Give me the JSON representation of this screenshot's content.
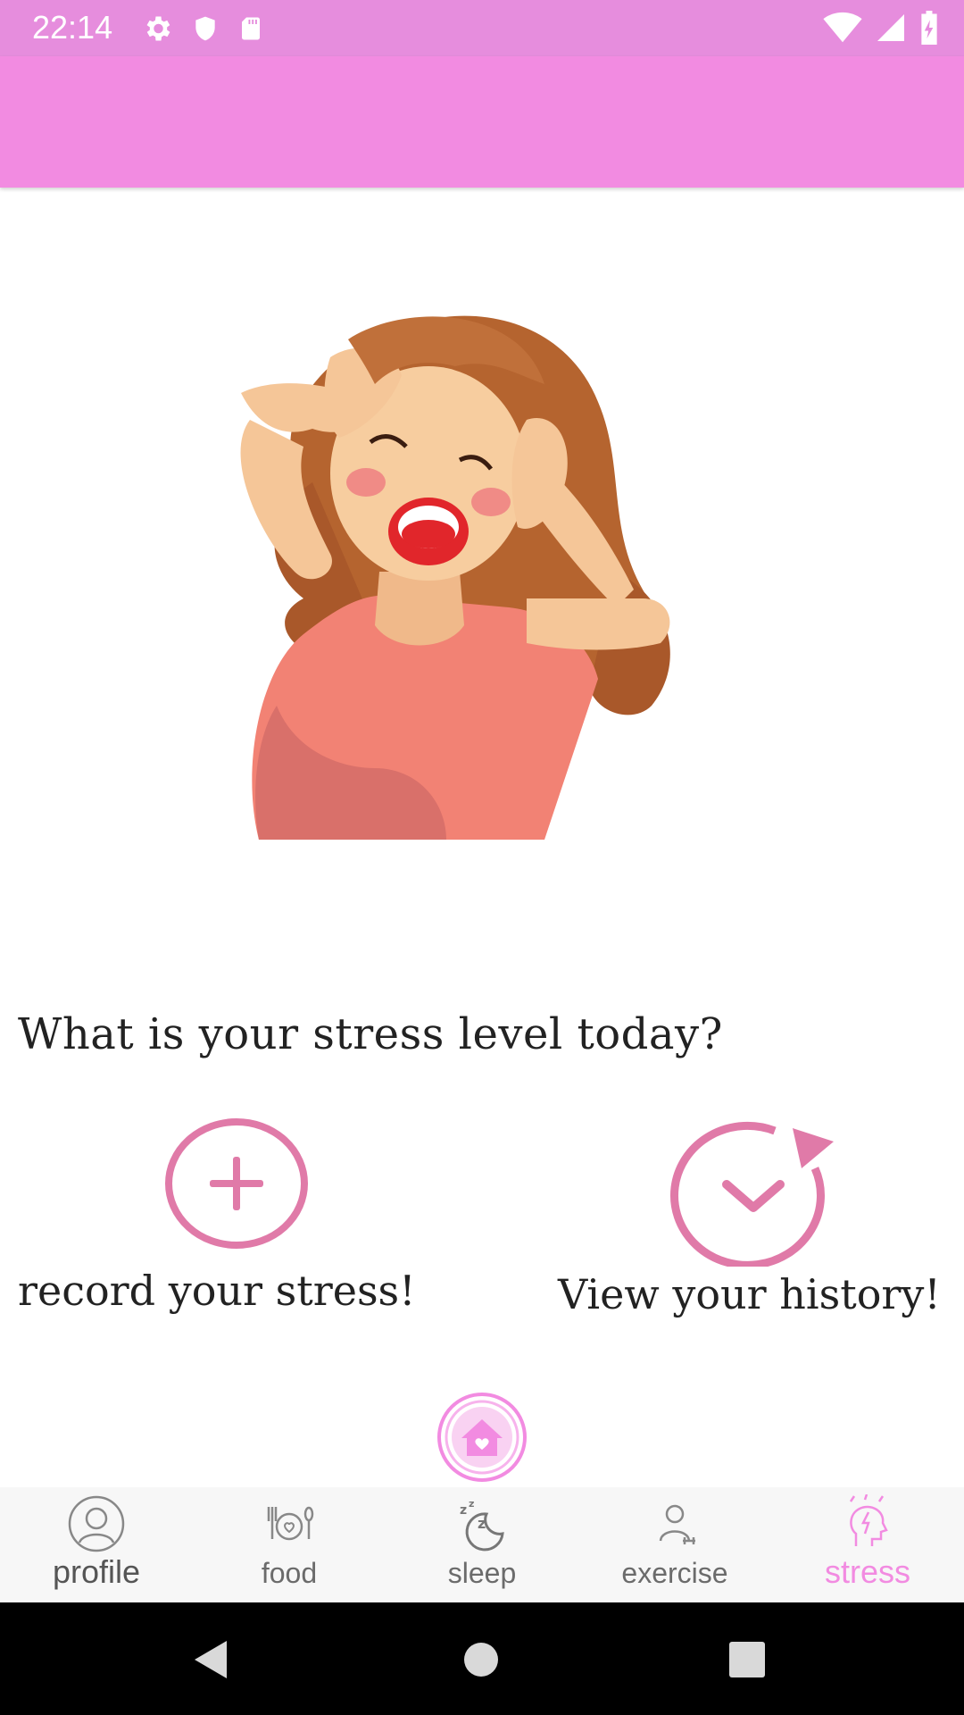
{
  "status_bar": {
    "time": "22:14",
    "left_icons": [
      "gear-icon",
      "shield-icon",
      "sd-card-icon"
    ],
    "right_icons": [
      "wifi-icon",
      "signal-icon",
      "battery-icon"
    ]
  },
  "main": {
    "question": "What is your stress level today?",
    "record_label": "record your stress!",
    "history_label": "View your history!"
  },
  "bottom_nav": {
    "items": [
      {
        "label": "profile",
        "icon": "profile-icon",
        "active": false
      },
      {
        "label": "food",
        "icon": "food-icon",
        "active": false
      },
      {
        "label": "sleep",
        "icon": "sleep-icon",
        "active": false
      },
      {
        "label": "exercise",
        "icon": "exercise-icon",
        "active": false
      },
      {
        "label": "stress",
        "icon": "stress-icon",
        "active": true
      }
    ]
  },
  "colors": {
    "status_bar": "#e68ddd",
    "app_bar": "#f28be1",
    "accent_pink": "#e07aa8",
    "active_tab": "#f28be1"
  }
}
